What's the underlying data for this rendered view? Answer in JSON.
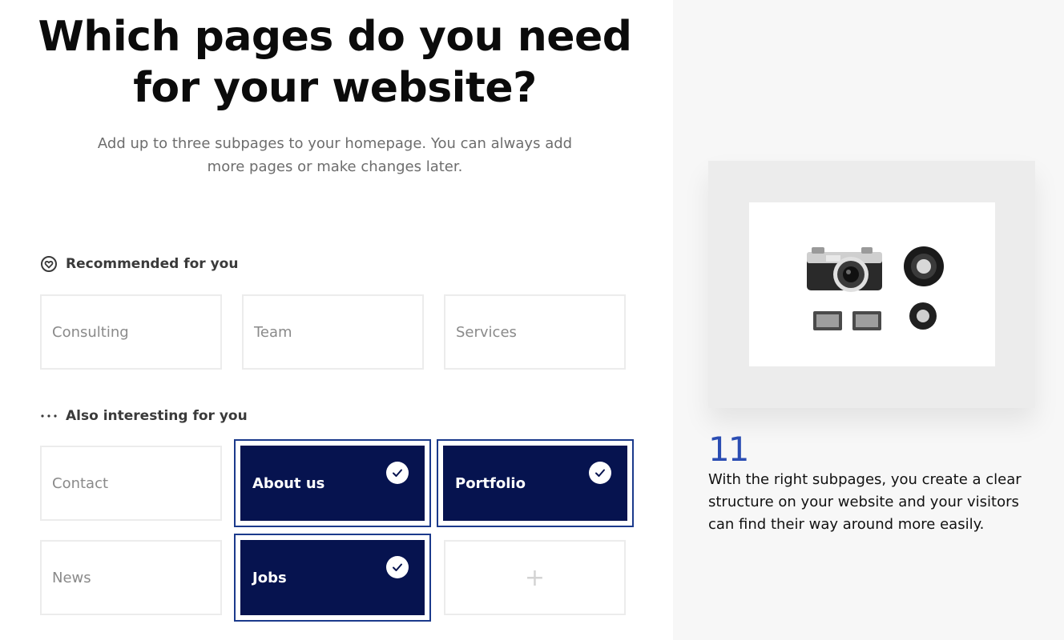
{
  "header": {
    "title": "Which pages do you need for your website?",
    "subtitle": "Add up to three subpages to your homepage. You can always add more pages or make changes later."
  },
  "sections": {
    "recommended": {
      "label": "Recommended for you",
      "icon": "heart-icon",
      "cards": [
        {
          "label": "Consulting",
          "selected": false
        },
        {
          "label": "Team",
          "selected": false
        },
        {
          "label": "Services",
          "selected": false
        }
      ]
    },
    "also": {
      "label": "Also interesting for you",
      "icon": "more-dots-icon",
      "cards": [
        {
          "label": "Contact",
          "selected": false
        },
        {
          "label": "About us",
          "selected": true
        },
        {
          "label": "Portfolio",
          "selected": true
        },
        {
          "label": "News",
          "selected": false
        },
        {
          "label": "Jobs",
          "selected": true
        }
      ],
      "add_label": "+"
    }
  },
  "side": {
    "step_number": "11",
    "description": "With the right subpages, you create a clear structure on your website and your visitors can find their way around more easily."
  },
  "colors": {
    "selected_bg": "#06134f",
    "selected_outline": "#1b3a8c",
    "accent_number": "#2b4db3"
  }
}
